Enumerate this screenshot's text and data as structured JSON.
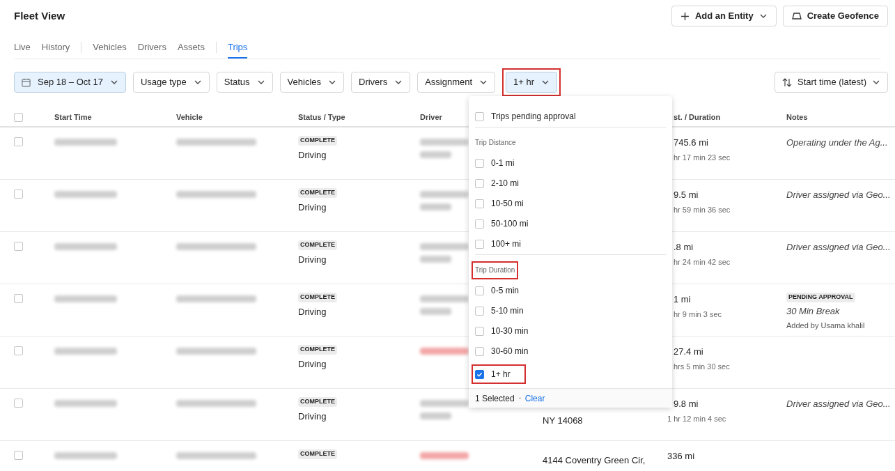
{
  "header": {
    "title": "Fleet View",
    "actions": [
      {
        "label": "Add an Entity",
        "kind": "add"
      },
      {
        "label": "Create Geofence",
        "kind": "geofence"
      }
    ]
  },
  "tabs": [
    {
      "label": "Live",
      "selected": false,
      "separator_before": false
    },
    {
      "label": "History",
      "selected": false,
      "separator_before": false
    },
    {
      "label": "Vehicles",
      "selected": false,
      "separator_before": true
    },
    {
      "label": "Drivers",
      "selected": false,
      "separator_before": false
    },
    {
      "label": "Assets",
      "selected": false,
      "separator_before": false
    },
    {
      "label": "Trips",
      "selected": true,
      "separator_before": true
    }
  ],
  "filters": [
    {
      "label": "Sep 18 – Oct 17",
      "kind": "date",
      "active": true,
      "highlighted": false
    },
    {
      "label": "Usage type",
      "kind": "select",
      "active": false,
      "highlighted": false
    },
    {
      "label": "Status",
      "kind": "select",
      "active": false,
      "highlighted": false
    },
    {
      "label": "Vehicles",
      "kind": "select",
      "active": false,
      "highlighted": false
    },
    {
      "label": "Drivers",
      "kind": "select",
      "active": false,
      "highlighted": false
    },
    {
      "label": "Assignment",
      "kind": "select",
      "active": false,
      "highlighted": false
    },
    {
      "label": "1+ hr",
      "kind": "select",
      "active": true,
      "highlighted": true
    }
  ],
  "sort": {
    "label": "Start time (latest)"
  },
  "table": {
    "select_all": {
      "checked": false
    },
    "columns": [
      {
        "label": "Start Time"
      },
      {
        "label": "Vehicle"
      },
      {
        "label": "Status / Type"
      },
      {
        "label": "Driver"
      },
      {},
      {
        "label": "st. / Duration"
      },
      {
        "label": "Notes"
      }
    ],
    "rows": [
      {
        "checked": false,
        "status": "COMPLETE",
        "type": "Driving",
        "driver_flagged": false,
        "address": [],
        "distance": "745.6 mi",
        "duration": "hr 17 min 23 sec",
        "notes": {
          "text": "Operating under the Ag..."
        }
      },
      {
        "checked": false,
        "status": "COMPLETE",
        "type": "Driving",
        "driver_flagged": false,
        "address": [],
        "distance": "9.5 mi",
        "duration": "hr 59 min 36 sec",
        "notes": {
          "text": "Driver assigned via Geo..."
        }
      },
      {
        "checked": false,
        "status": "COMPLETE",
        "type": "Driving",
        "driver_flagged": false,
        "address": [],
        "distance": ".8 mi",
        "duration": "hr 24 min 42 sec",
        "notes": {
          "text": "Driver assigned via Geo..."
        }
      },
      {
        "checked": false,
        "status": "COMPLETE",
        "type": "Driving",
        "driver_flagged": false,
        "address": [],
        "distance": "1 mi",
        "duration": "hr 9 min 3 sec",
        "notes": {
          "badge": "PENDING APPROVAL",
          "text": "30 Min Break",
          "byline": "Added by Usama khalil"
        }
      },
      {
        "checked": false,
        "status": "COMPLETE",
        "type": "Driving",
        "driver_flagged": true,
        "address": [],
        "distance": "27.4 mi",
        "duration": "hrs 5 min 30 sec"
      },
      {
        "checked": false,
        "status": "COMPLETE",
        "type": "Driving",
        "driver_flagged": false,
        "address": [
          "NY 14068"
        ],
        "distance": "9.8 mi",
        "duration": "1 hr 12 min 4 sec",
        "notes": {
          "text": "Driver assigned via Geo..."
        }
      },
      {
        "checked": false,
        "status": "COMPLETE",
        "driver_flagged": true,
        "address": [
          "4144 Coventry Green Cir,"
        ],
        "distance": "336 mi"
      }
    ]
  },
  "dropdown": {
    "sections": [
      {
        "options": [
          {
            "label": "Trips pending approval",
            "checked": false,
            "highlighted": false
          }
        ]
      },
      {
        "title": "Trip Distance",
        "highlighted": false,
        "options": [
          {
            "label": "0-1 mi",
            "checked": false,
            "highlighted": false
          },
          {
            "label": "2-10 mi",
            "checked": false,
            "highlighted": false
          },
          {
            "label": "10-50 mi",
            "checked": false,
            "highlighted": false
          },
          {
            "label": "50-100 mi",
            "checked": false,
            "highlighted": false
          },
          {
            "label": "100+ mi",
            "checked": false,
            "highlighted": false
          }
        ]
      },
      {
        "title": "Trip Duration",
        "highlighted": true,
        "options": [
          {
            "label": "0-5 min",
            "checked": false,
            "highlighted": false
          },
          {
            "label": "5-10 min",
            "checked": false,
            "highlighted": false
          },
          {
            "label": "10-30 min",
            "checked": false,
            "highlighted": false
          },
          {
            "label": "30-60 min",
            "checked": false,
            "highlighted": false
          },
          {
            "label": "1+ hr",
            "checked": true,
            "highlighted": true
          }
        ]
      }
    ],
    "footer": {
      "count": "1 Selected",
      "action": "Clear"
    }
  }
}
